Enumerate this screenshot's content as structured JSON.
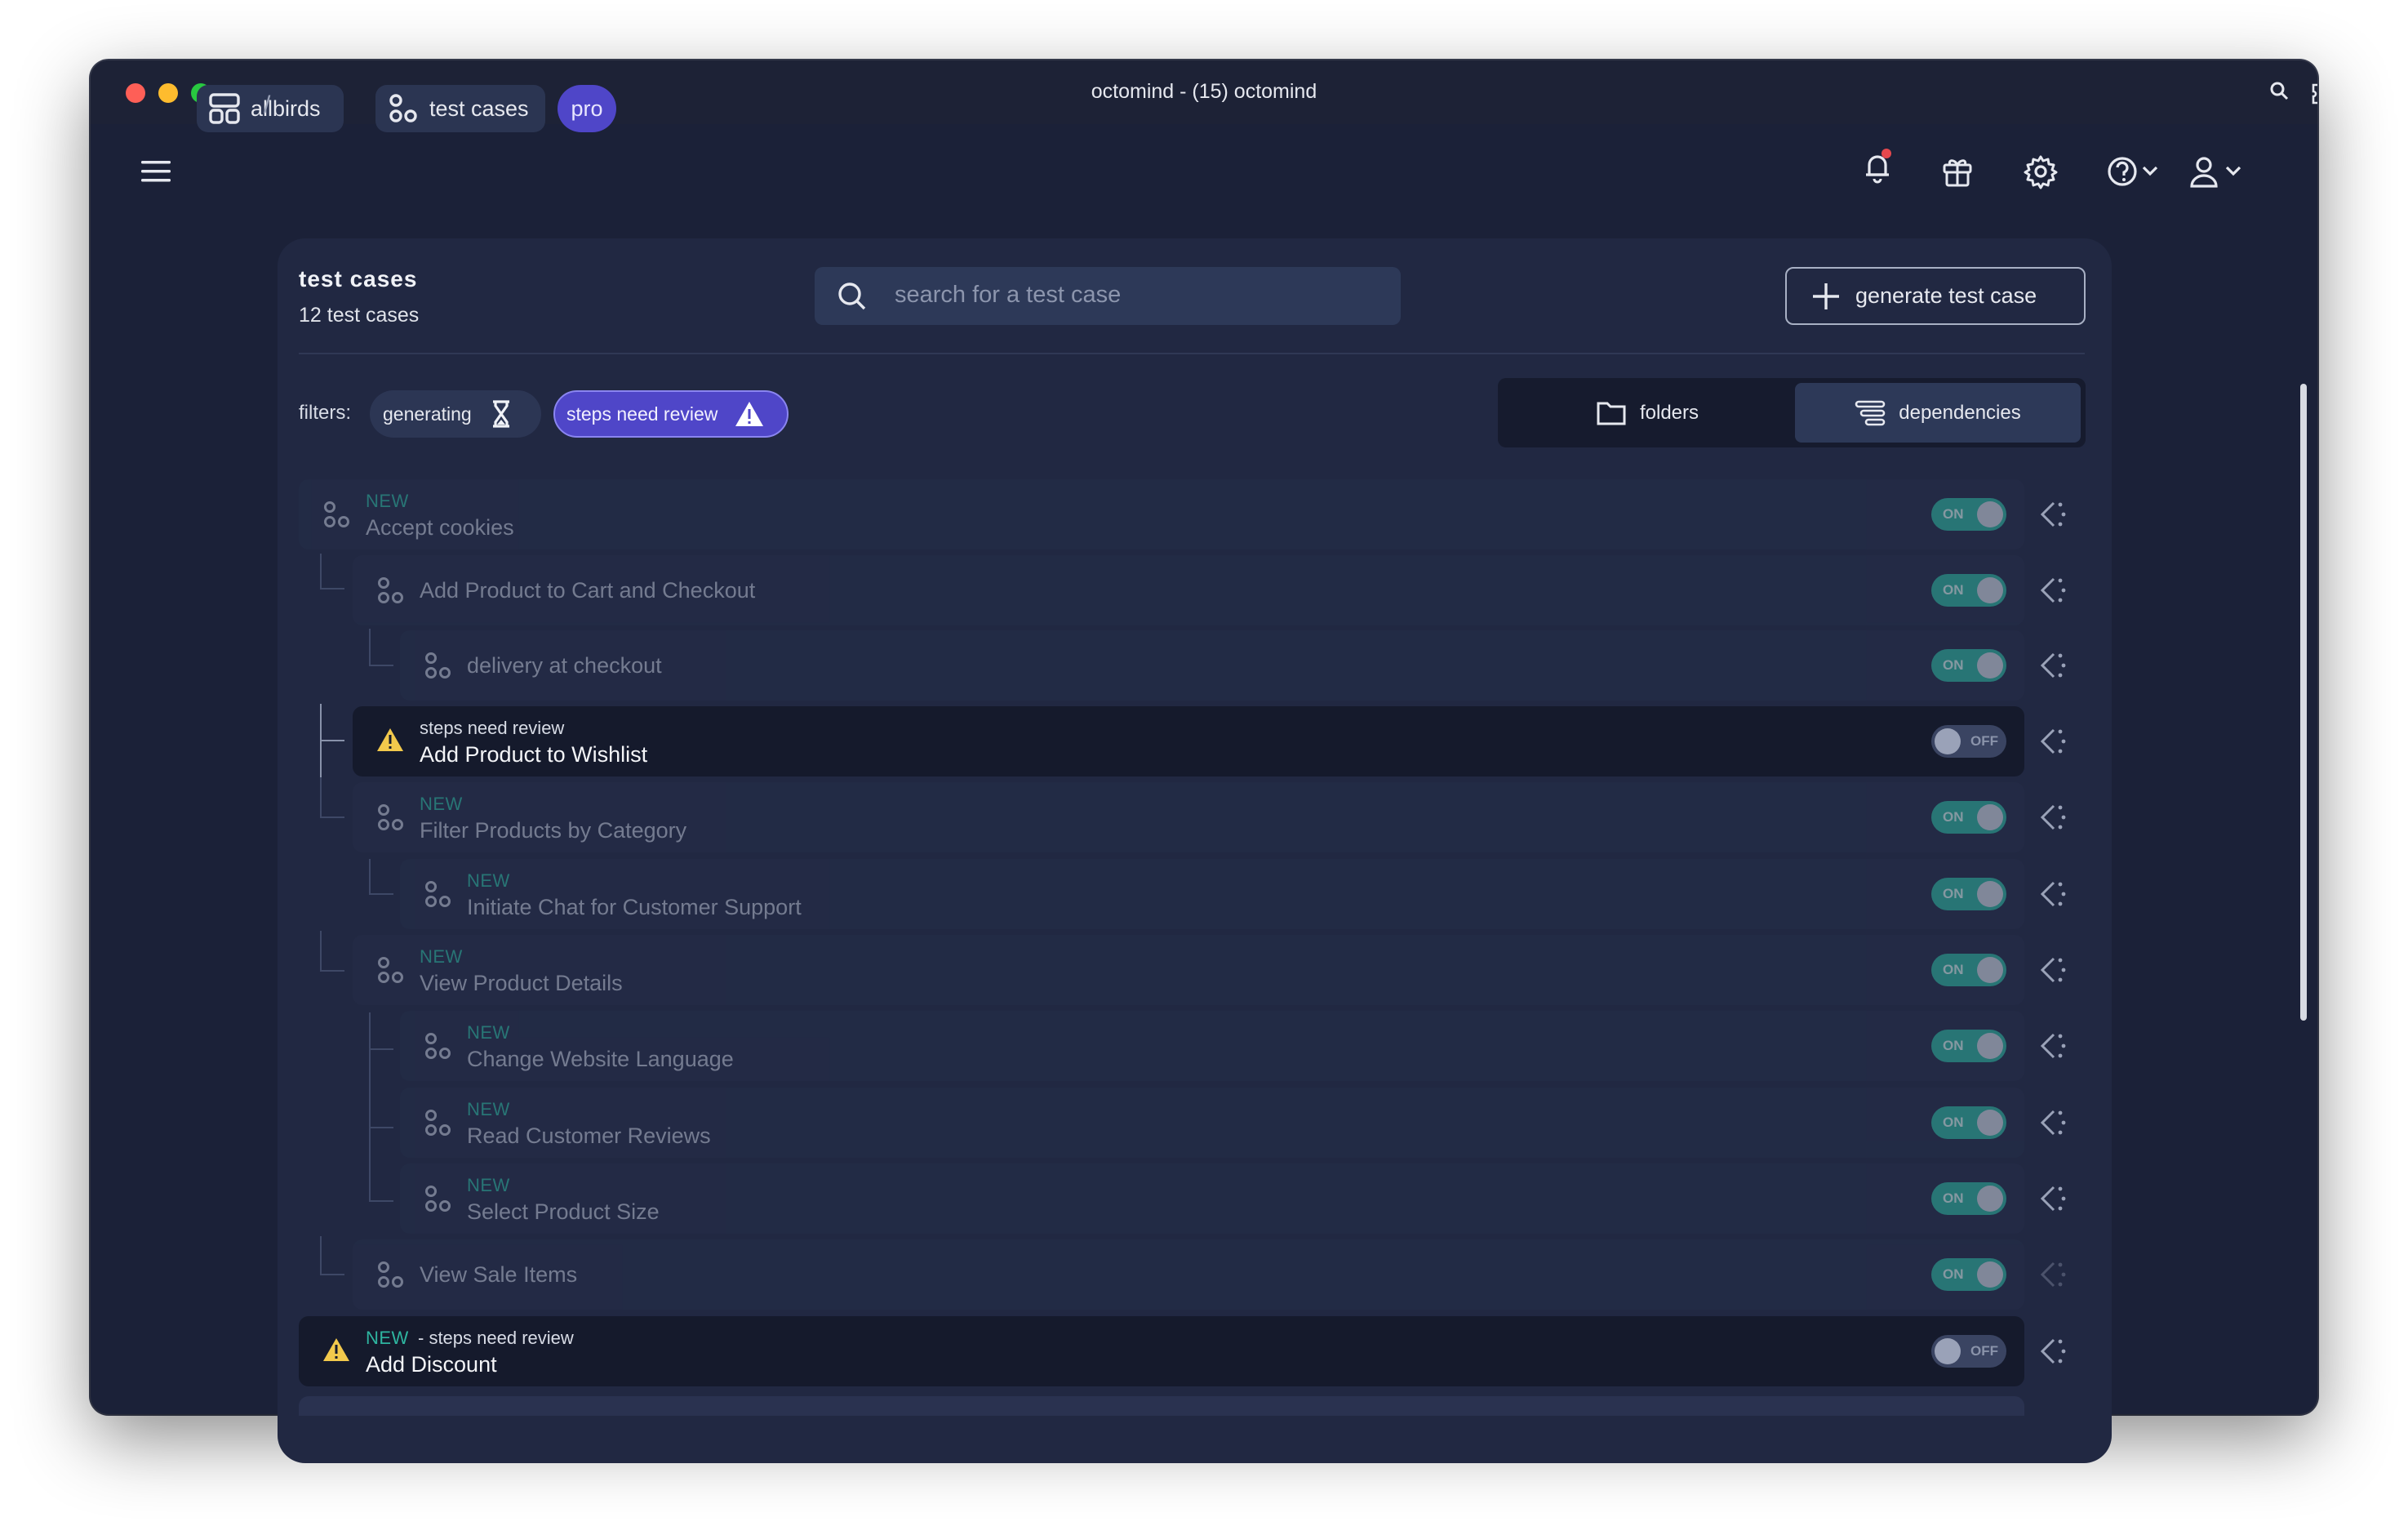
{
  "window": {
    "title": "octomind - (15) octomind"
  },
  "breadcrumb": {
    "project": "allbirds",
    "separator": "/",
    "section": "test cases",
    "plan_badge": "pro"
  },
  "header_icons": [
    "menu-icon",
    "bell-icon",
    "gift-icon",
    "gear-icon",
    "help-icon",
    "user-icon"
  ],
  "panel": {
    "title": "test cases",
    "subtitle": "12 test cases",
    "search_placeholder": "search for a test case",
    "generate_label": "generate test case"
  },
  "filters": {
    "label": "filters:",
    "chips": [
      {
        "label": "generating",
        "icon": "hourglass-icon",
        "active": false
      },
      {
        "label": "steps need review",
        "icon": "warning-icon",
        "active": true
      }
    ]
  },
  "view_toggle": {
    "folders": "folders",
    "dependencies": "dependencies",
    "selected": "dependencies"
  },
  "test_cases": [
    {
      "badge": "NEW",
      "name": "Accept cookies",
      "depth": 0,
      "toggle": "ON",
      "dimmed": true
    },
    {
      "badge": "",
      "name": "Add Product to Cart and Checkout",
      "depth": 1,
      "toggle": "ON",
      "dimmed": true
    },
    {
      "badge": "",
      "name": "delivery at checkout",
      "depth": 2,
      "toggle": "ON",
      "dimmed": true
    },
    {
      "badge": "steps need review",
      "name": "Add Product to Wishlist",
      "depth": 1,
      "toggle": "OFF",
      "dimmed": false,
      "warning": true
    },
    {
      "badge": "NEW",
      "name": "Filter Products by Category",
      "depth": 1,
      "toggle": "ON",
      "dimmed": true
    },
    {
      "badge": "NEW",
      "name": "Initiate Chat for Customer Support",
      "depth": 2,
      "toggle": "ON",
      "dimmed": true
    },
    {
      "badge": "NEW",
      "name": "View Product Details",
      "depth": 1,
      "toggle": "ON",
      "dimmed": true
    },
    {
      "badge": "NEW",
      "name": "Change Website Language",
      "depth": 2,
      "toggle": "ON",
      "dimmed": true
    },
    {
      "badge": "NEW",
      "name": "Read Customer Reviews",
      "depth": 2,
      "toggle": "ON",
      "dimmed": true
    },
    {
      "badge": "NEW",
      "name": "Select Product Size",
      "depth": 2,
      "toggle": "ON",
      "dimmed": true
    },
    {
      "badge": "",
      "name": "View Sale Items",
      "depth": 1,
      "toggle": "ON",
      "dimmed": true
    },
    {
      "badge": "NEW",
      "badge_suffix": " - steps need review",
      "name": "Add Discount",
      "depth": 0,
      "toggle": "OFF",
      "dimmed": false,
      "warning": true
    }
  ],
  "colors": {
    "window_bg": "#1b2138",
    "panel_bg": "#212842",
    "accent": "#4f46c8",
    "new_badge": "#2eb5a0",
    "warning": "#f2c94c"
  }
}
